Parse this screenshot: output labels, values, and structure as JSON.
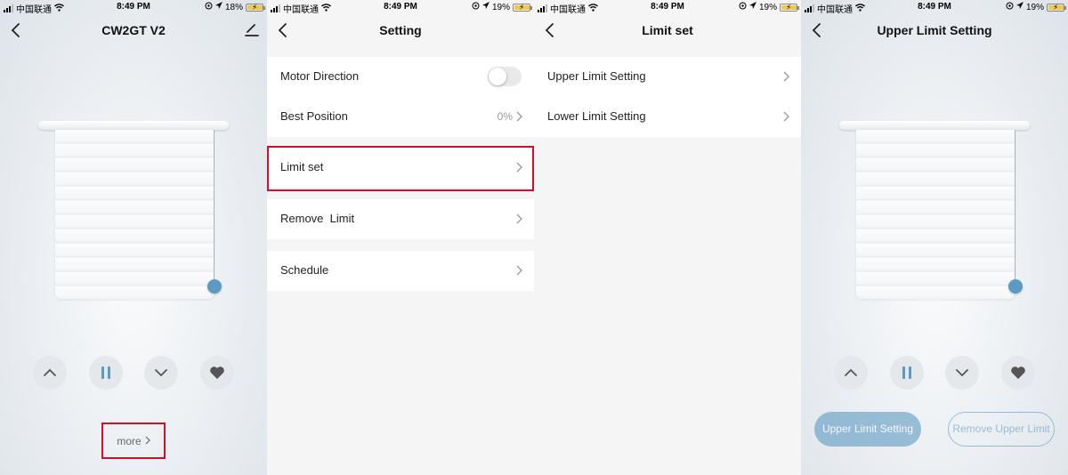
{
  "status_bars": [
    {
      "carrier": "中国联通",
      "time": "8:49 PM",
      "battery": "18%"
    },
    {
      "carrier": "中国联通",
      "time": "8:49 PM",
      "battery": "19%"
    },
    {
      "carrier": "中国联通",
      "time": "8:49 PM",
      "battery": "19%"
    },
    {
      "carrier": "中国联通",
      "time": "8:49 PM",
      "battery": "19%"
    }
  ],
  "screen1": {
    "title": "CW2GT V2",
    "more_label": "more",
    "controls": [
      "chevron-up-icon",
      "pause-icon",
      "chevron-down-icon",
      "heart-icon"
    ]
  },
  "screen2": {
    "title": "Setting",
    "motor_direction": "Motor Direction",
    "motor_direction_on": false,
    "best_position": "Best Position",
    "best_position_value": "0%",
    "limit_set": "Limit set",
    "remove_limit": "Remove  Limit",
    "schedule": "Schedule"
  },
  "screen3": {
    "title": "Limit set",
    "items": [
      "Upper Limit Setting",
      "Lower Limit Setting"
    ]
  },
  "screen4": {
    "title": "Upper Limit Setting",
    "primary_button": "Upper Limit Setting",
    "secondary_button": "Remove Upper Limit"
  },
  "colors": {
    "accent": "#5d9ac3",
    "highlight": "#d0102a",
    "group_bg": "#ffffff",
    "page_bg": "#f5f5f5"
  }
}
